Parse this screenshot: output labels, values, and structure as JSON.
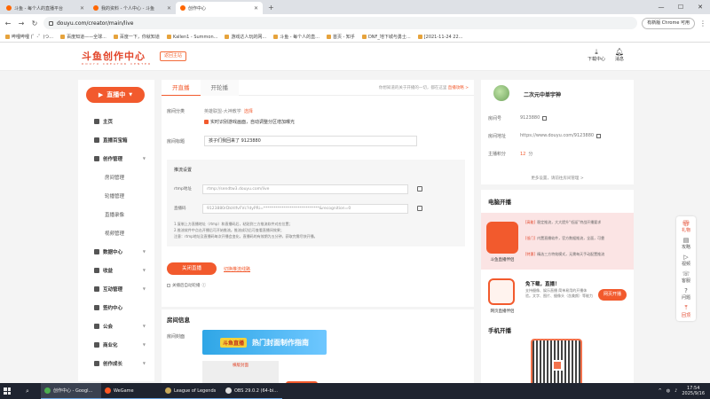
{
  "browser": {
    "tabs": [
      {
        "title": "斗鱼 - 每个人的直播平台"
      },
      {
        "title": "我的资料 - 个人中心 - 斗鱼"
      },
      {
        "title": "创作中心",
        "active": true
      }
    ],
    "new_tab": "+",
    "url": "douyu.com/creator/main/live",
    "promo": "有新版 Chrome 可用",
    "bookmarks": [
      "哔哩哔哩 (゜-゜)つ...",
      "百度知道——全球...",
      "百度一下，你就知道",
      "Kallen1 - Summon...",
      "游戏达人玩的网...",
      "斗鱼 - 每个人的直...",
      "首页 - 知乎",
      "DNF_地下城与勇士...",
      "[2021-11-24 22..."
    ]
  },
  "header": {
    "logo": "斗鱼创作中心",
    "logo_sub": "DOUYU CREATOR CENTER",
    "home_button": "返回主站",
    "download": "下载中心",
    "messages": "消息"
  },
  "sidebar": {
    "live_button": "直播中",
    "items": [
      {
        "label": "主页",
        "level": "top"
      },
      {
        "label": "直播百宝箱",
        "level": "top"
      },
      {
        "label": "创作管理",
        "level": "top",
        "expand": true
      },
      {
        "label": "房间管理",
        "level": "sub"
      },
      {
        "label": "轮播管理",
        "level": "sub"
      },
      {
        "label": "直播录像",
        "level": "sub"
      },
      {
        "label": "视频管理",
        "level": "sub"
      },
      {
        "label": "数据中心",
        "level": "top",
        "expand": true
      },
      {
        "label": "收益",
        "level": "top",
        "expand": true
      },
      {
        "label": "互动管理",
        "level": "top",
        "expand": true
      },
      {
        "label": "签约中心",
        "level": "top"
      },
      {
        "label": "公会",
        "level": "top",
        "expand": true
      },
      {
        "label": "商业化",
        "level": "top",
        "expand": true
      },
      {
        "label": "创作成长",
        "level": "top",
        "expand": true
      }
    ]
  },
  "main": {
    "tabs": [
      "开直播",
      "开轮播"
    ],
    "announcement_prefix": "你想知道的关于开播的一切，都在这里",
    "announcement_link": "直播攻略 >",
    "category_label": "房间分类",
    "category_value": "英雄联盟-大神教学",
    "category_action": "选择",
    "realtime_check": "实时识别游戏画面，自动调整分区增加曝光",
    "title_label": "房间标题",
    "title_value": "孩子们我回来了 9123880",
    "push_title": "推流设置",
    "rtmp_label": "rtmp地址",
    "rtmp_value": "rtmp://sendtw3.douyu.com/live",
    "code_label": "直播码",
    "code_value": "9123880rDkHlfvFVc?dyPRi=****************************&recognition=0",
    "notes": [
      "1.复制上方直播地址（rtmp）和直播码后，粘贴到三方推流软件对应位置；",
      "2.推流软件中点击开播后可开始推流。推流成功后可查看直播间效果；",
      "注意：rtmp地址及直播码每次开播会变化，直播码的有效期为五分钟，获取完需尽快开播。"
    ],
    "close_button": "关闭直播",
    "switch_link": "切换推流线路",
    "auto_record": "关播后自动轮播"
  },
  "room_info": {
    "title": "房间信息",
    "cover_label": "房间封面",
    "cover_text": "斗鱼直播",
    "cover_sub": "热门封面制作指南",
    "cover2_label": "横版封面"
  },
  "profile": {
    "name": "二次元中单宇神",
    "room_no_label": "房间号",
    "room_no": "9123880",
    "room_url_label": "房间地址",
    "room_url": "https://www.douyu.com/9123880",
    "score_label": "主播积分",
    "score": "12",
    "score_unit": "分",
    "more_settings": "更多设置，请前往房间管理 >"
  },
  "pc_live": {
    "title": "电脑开播",
    "companion_name": "斗鱼直播伴侣",
    "features": [
      {
        "tag": "[高能]",
        "text": "稳定推流，大大提升“低延”特战开播要求"
      },
      {
        "tag": "[低门]",
        "text": "内置直播软件，官方数据推流，全面，可靠"
      },
      {
        "tag": "[特惠]",
        "text": "精选三方特效模式，无需每天手动配置推流"
      }
    ],
    "web_title": "免下载，直播！",
    "web_desc": "支持摄像、娱乐直播 简单易用的开播体验。文字、图片、摄像头（含美颜）等能力",
    "web_button": "网页开播",
    "web_caption": "网页直播伴侣",
    "mobile_title": "手机开播"
  },
  "float_bar": [
    "礼物",
    "攻略",
    "视频",
    "客服",
    "问题",
    "回顶"
  ],
  "taskbar": {
    "items": [
      "创作中心 - Googl...",
      "WeGame",
      "League of Legends",
      "OBS 29.0.2 (64-bi..."
    ],
    "time": "17:54",
    "date": "2025/9/16"
  }
}
